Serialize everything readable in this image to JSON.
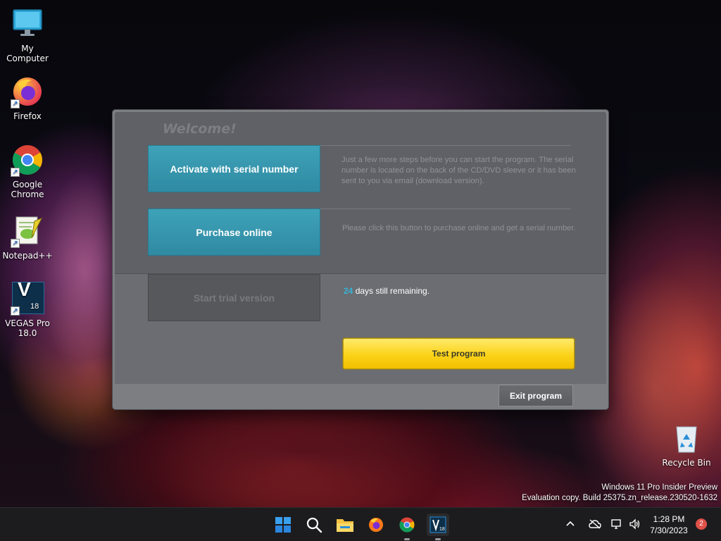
{
  "desktop": {
    "icons": [
      {
        "label": "My Computer",
        "icon": "monitor-icon"
      },
      {
        "label": "Firefox",
        "icon": "firefox-icon"
      },
      {
        "label": "Google Chrome",
        "icon": "chrome-icon"
      },
      {
        "label": "Notepad++",
        "icon": "notepad-plus-plus-icon"
      },
      {
        "label": "VEGAS Pro 18.0",
        "icon": "vegas-pro-icon"
      },
      {
        "label": "Recycle Bin",
        "icon": "recycle-bin-icon"
      }
    ],
    "vegas_badge": "V",
    "vegas_badge_num": "18"
  },
  "dialog": {
    "welcome": "Welcome!",
    "activate_label": "Activate with serial number",
    "activate_desc": "Just a few more steps before you can start the program. The serial number is located on the back of the CD/DVD sleeve or it has been sent to you via email (download version).",
    "purchase_label": "Purchase online",
    "purchase_desc": "Please click this button to purchase online and get a serial number.",
    "trial_label": "Start trial version",
    "days_remaining": "24",
    "days_text": " days still remaining.",
    "test_label": "Test program",
    "exit_label": "Exit program"
  },
  "watermark": {
    "line1": "Windows 11 Pro Insider Preview",
    "line2": "Evaluation copy. Build 25375.zn_release.230520-1632"
  },
  "taskbar": {
    "apps": [
      "start-icon",
      "search-icon",
      "file-explorer-icon",
      "firefox-icon",
      "chrome-icon",
      "vegas-pro-icon"
    ],
    "tray_icons": [
      "chevron-up-icon",
      "cloud-off-icon",
      "network-icon",
      "volume-icon"
    ],
    "time": "1:28 PM",
    "date": "7/30/2023",
    "notification_count": "2"
  },
  "colors": {
    "accent_blue": "#3ea2b8",
    "test_yellow": "#fbd31a",
    "days_highlight": "#35b3d6"
  }
}
